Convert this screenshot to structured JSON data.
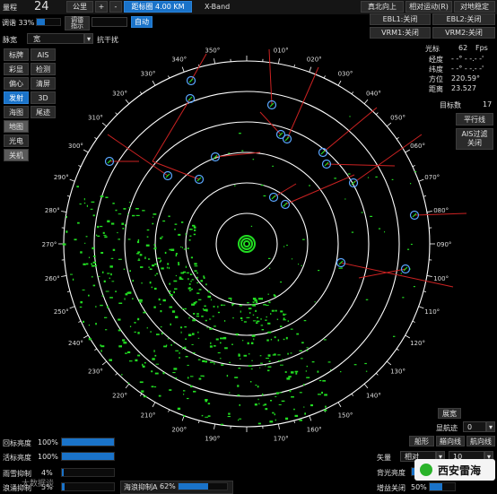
{
  "top": {
    "range_label": "量程",
    "range_value": "24",
    "range_unit": "公里",
    "plus": "+",
    "minus": "-",
    "ring_label": "距标圈 4.00 KM",
    "band": "X-Band",
    "north_up": "真北向上",
    "relative_motion": "相对运动(R)",
    "ground_stab": "对地稳定"
  },
  "left": {
    "gain": "调谐 33%",
    "tune_manual": "调谐\n指示",
    "auto": "自动",
    "pulse_label": "脉宽",
    "pulse_value": "宽",
    "anti_interference": "抗干扰",
    "buttons": [
      "标牌",
      "AIS",
      "彩显",
      "检测",
      "偏心",
      "清屏",
      "发射",
      "3D",
      "海图",
      "尾迹",
      "地图",
      "光电",
      "关机"
    ]
  },
  "right": {
    "ebl1": "EBL1:关闭",
    "ebl2": "EBL2:关闭",
    "vrm1": "VRM1:关闭",
    "vrm2": "VRM2:关闭",
    "cursor_label": "光标",
    "fps_value": "62",
    "fps_unit": "Fps",
    "lon_label": "经度",
    "lon_value": "- -° - -.- -'",
    "lat_label": "纬度",
    "lat_value": "- -° - -.- -'",
    "bearing_label": "方位",
    "bearing_value": "220.59°",
    "dist_label": "距离",
    "dist_value": "23.527",
    "target_count_label": "目标数",
    "target_count_value": "17",
    "parallel_lines": "平行线",
    "ais_filter": "AIS过滤\n关闭"
  },
  "bottom_left": {
    "sliders": [
      {
        "label": "回标亮度",
        "value": "100%",
        "level": 1.0
      },
      {
        "label": "活标亮度",
        "value": "100%",
        "level": 1.0
      },
      {
        "label": "雨雪抑制",
        "value": "4%",
        "level": 0.04
      },
      {
        "label": "浪涌抑制",
        "value": "5%",
        "level": 0.05
      }
    ],
    "watermark": "大数据谈"
  },
  "bottom_center": {
    "sea_clutter_label": "海浪抑制A",
    "sea_clutter_value": "62%",
    "sea_clutter_level": 0.62
  },
  "bottom_right": {
    "expand": "展宽",
    "track_points_label": "显航迹",
    "track_points_value": "0",
    "ship_shape": "船形",
    "heading_line": "艏向线",
    "track_line": "航向线",
    "vector_label": "矢量",
    "vector_mode": "相对",
    "vector_value": "10",
    "backlight_label": "背光亮度",
    "gain_off_label": "增益关闭",
    "gain_off_value": "50%",
    "gain_off_level": 0.5,
    "brand": "西安雷海"
  },
  "radar": {
    "bearing_labels": [
      "350°",
      "010°",
      "020°",
      "030°",
      "040°",
      "050°",
      "060°",
      "070°",
      "080°",
      "090°",
      "100°",
      "110°",
      "120°",
      "130°",
      "140°",
      "150°",
      "160°",
      "170°",
      "190°",
      "200°",
      "210°",
      "220°",
      "230°",
      "240°",
      "250°",
      "260°",
      "270°",
      "280°",
      "290°",
      "300°",
      "310°",
      "320°",
      "330°",
      "340°"
    ],
    "colors": {
      "ring": "#ffffff",
      "echo": "#22dd22",
      "vector": "#cc2222",
      "target": "#5aa6ff"
    }
  }
}
